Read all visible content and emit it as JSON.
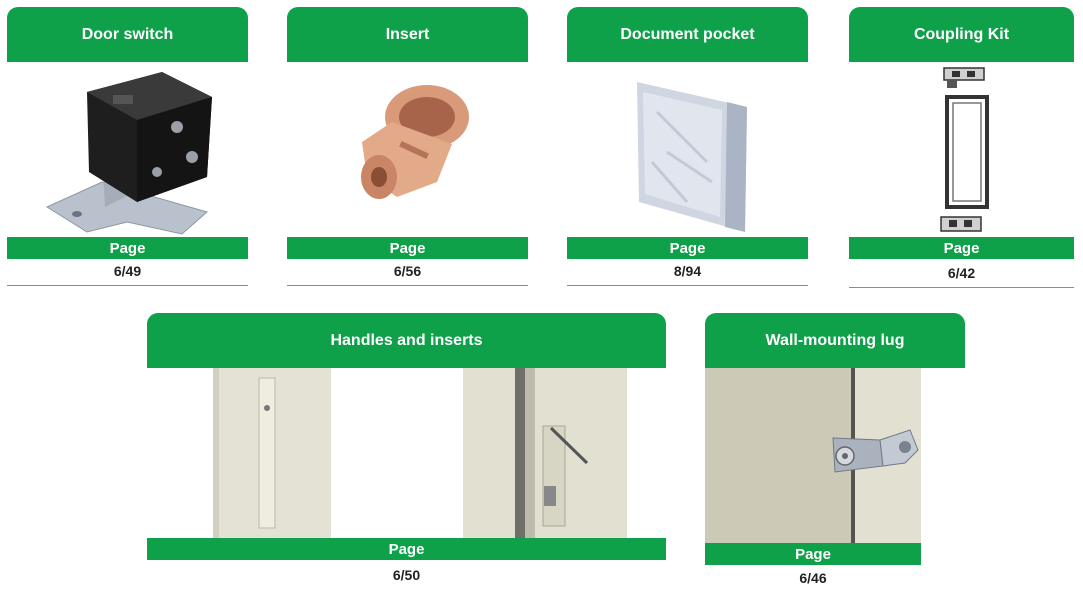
{
  "colors": {
    "accent_green": "#0fa04a",
    "rule_grey": "#8c8c8c"
  },
  "cards": [
    {
      "title": "Door switch",
      "page_label": "Page",
      "page_ref": "6/49"
    },
    {
      "title": "Insert",
      "page_label": "Page",
      "page_ref": "6/56"
    },
    {
      "title": "Document pocket",
      "page_label": "Page",
      "page_ref": "8/94"
    },
    {
      "title": "Coupling Kit",
      "page_label": "Page",
      "page_ref": "6/42"
    },
    {
      "title": "Handles and inserts",
      "page_label": "Page",
      "page_ref": "6/50"
    },
    {
      "title": "Wall-mounting lug",
      "page_label": "Page",
      "page_ref": "6/46"
    }
  ]
}
